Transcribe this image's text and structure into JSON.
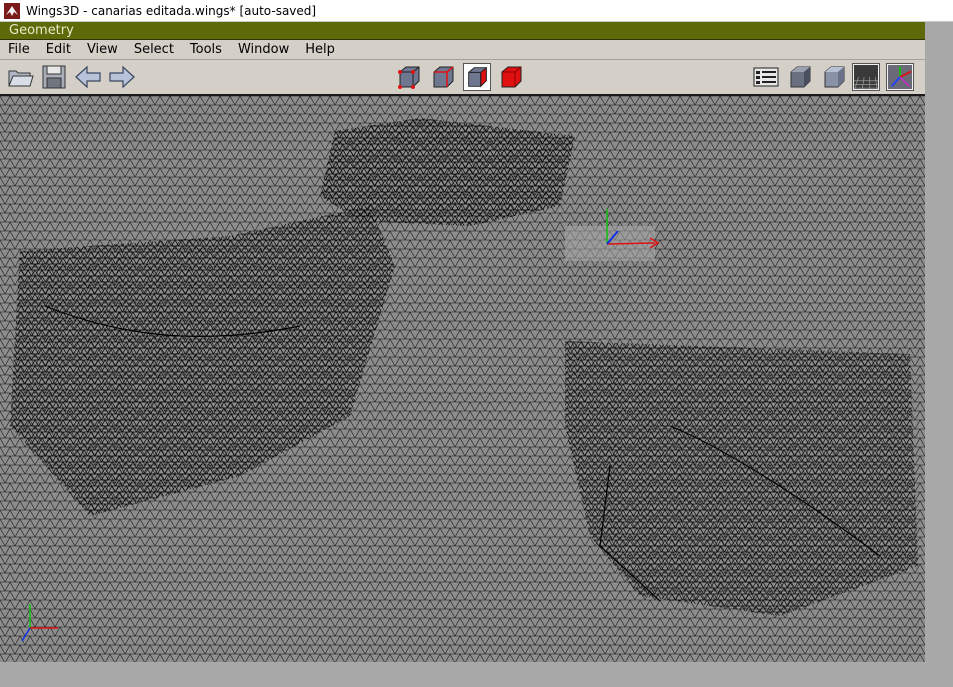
{
  "window_title": "Wings3D - canarias editada.wings* [auto-saved]",
  "panel_title": "Geometry",
  "menu": [
    {
      "label": "File"
    },
    {
      "label": "Edit"
    },
    {
      "label": "View"
    },
    {
      "label": "Select"
    },
    {
      "label": "Tools"
    },
    {
      "label": "Window"
    },
    {
      "label": "Help"
    }
  ],
  "toolbar": {
    "left": [
      "open-folder-icon",
      "save-disk-icon",
      "undo-arrow-icon",
      "redo-arrow-icon"
    ],
    "selection_modes": [
      "vertex-mode-icon",
      "edge-mode-icon",
      "face-mode-icon",
      "body-mode-icon"
    ],
    "active_selection_mode": "face",
    "right": [
      "outliner-icon",
      "smooth-shading-icon",
      "flat-shading-icon",
      "groundplane-icon",
      "axes-icon"
    ]
  },
  "colors": {
    "panel_header": "#5e6a0a",
    "viewport_bg": "#8d8d8d",
    "mesh_line": "#000000",
    "axis_x": "#e01010",
    "axis_y": "#10c010",
    "axis_z": "#1030e0"
  }
}
